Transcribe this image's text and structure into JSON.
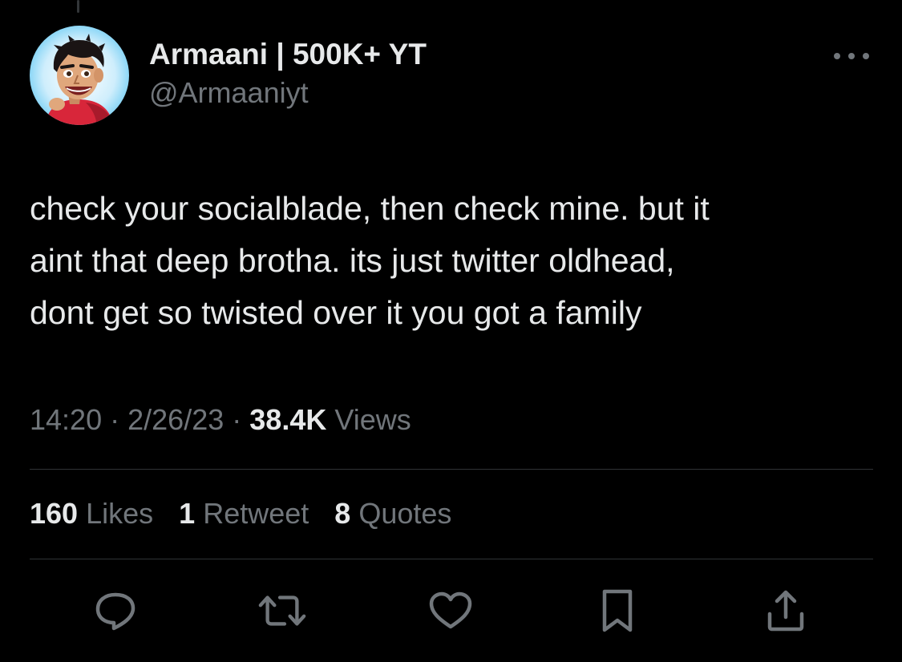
{
  "author": {
    "display_name": "Armaani | 500K+ YT",
    "handle": "@Armaaniyt",
    "avatar_icon": "cartoon-avatar"
  },
  "tweet": {
    "text": "check your socialblade, then check mine. but it\naint that deep brotha. its just twitter oldhead,\ndont get so twisted over it you got a family"
  },
  "meta": {
    "time": "14:20",
    "date": "2/26/23",
    "separator": "·",
    "views_count": "38.4K",
    "views_label": "Views"
  },
  "stats": {
    "likes_count": "160",
    "likes_label": "Likes",
    "retweets_count": "1",
    "retweets_label": "Retweet",
    "quotes_count": "8",
    "quotes_label": "Quotes"
  },
  "actions": [
    {
      "icon": "reply-icon"
    },
    {
      "icon": "retweet-icon"
    },
    {
      "icon": "like-icon"
    },
    {
      "icon": "bookmark-icon"
    },
    {
      "icon": "share-icon"
    }
  ],
  "colors": {
    "background": "#000000",
    "primary_text": "#e7e9ea",
    "secondary_text": "#71767b",
    "divider": "#2f3336"
  }
}
